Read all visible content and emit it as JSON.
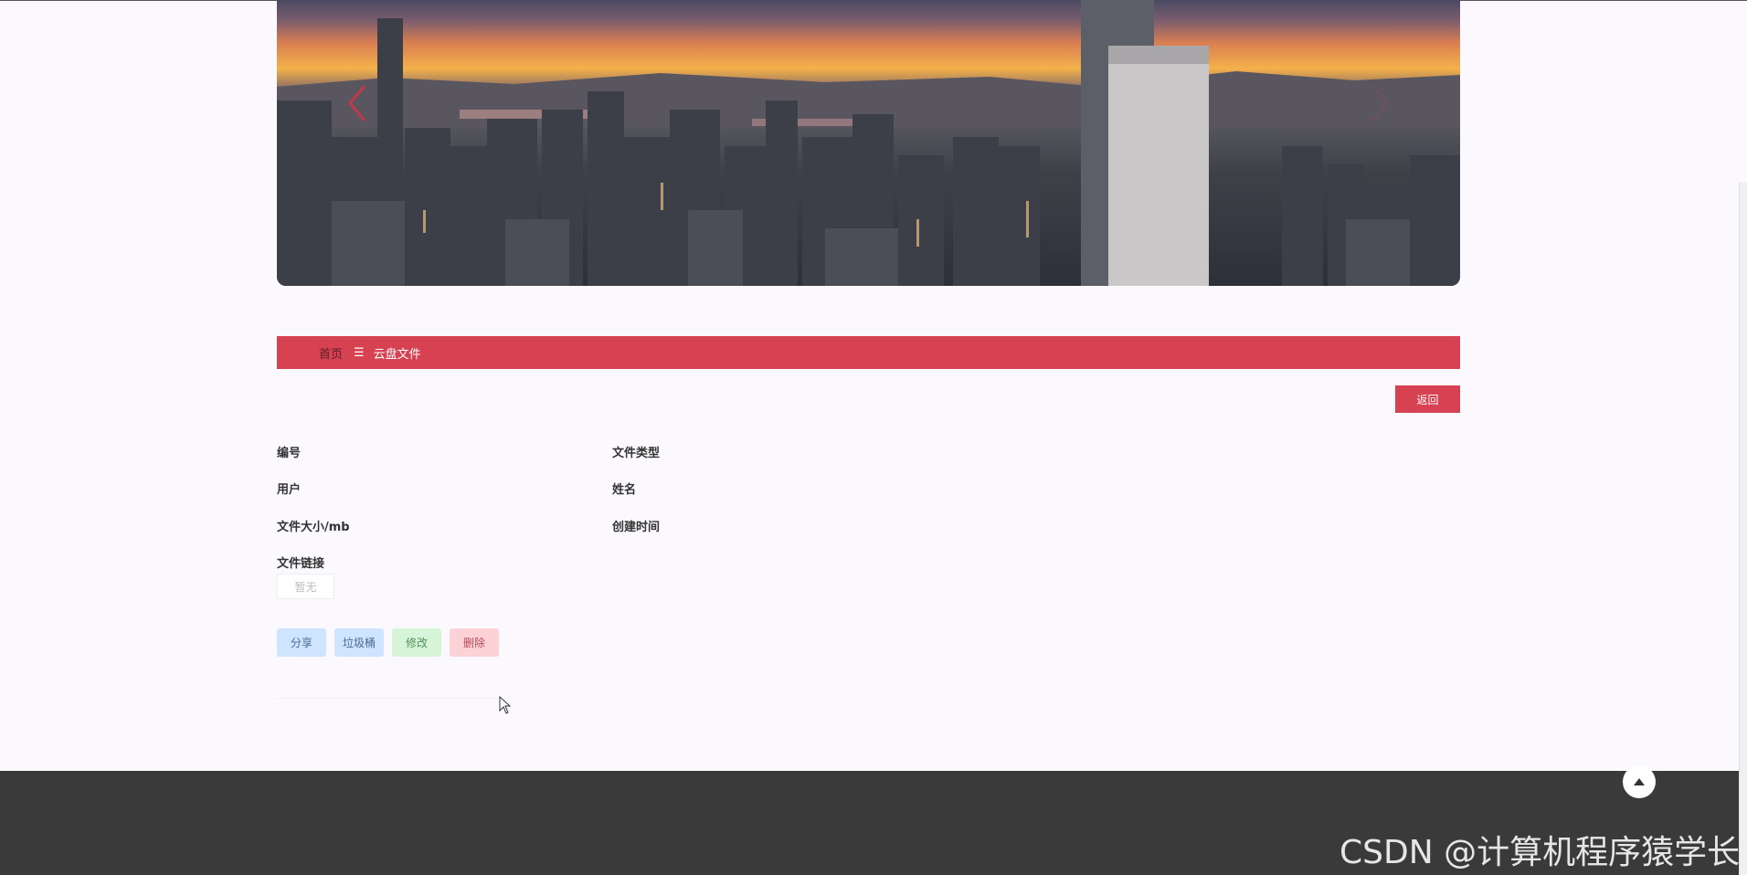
{
  "breadcrumb": {
    "home": "首页",
    "separator": "☰",
    "current": "云盘文件"
  },
  "actions": {
    "back": "返回",
    "share": "分享",
    "trash": "垃圾桶",
    "edit": "修改",
    "delete": "删除"
  },
  "fields": {
    "id": "编号",
    "file_type": "文件类型",
    "user": "用户",
    "name": "姓名",
    "file_size": "文件大小/mb",
    "created_at": "创建时间",
    "file_link": "文件链接"
  },
  "file_link_value": "暂无",
  "watermark": "CSDN @计算机程序猿学长",
  "colors": {
    "accent": "#d74252",
    "footer": "#3a3a3a",
    "background": "#fbf9fd"
  },
  "icons": {
    "prev": "chevron-left-icon",
    "next": "chevron-right-icon",
    "to_top": "caret-up-icon",
    "cursor": "mouse-pointer-icon"
  }
}
